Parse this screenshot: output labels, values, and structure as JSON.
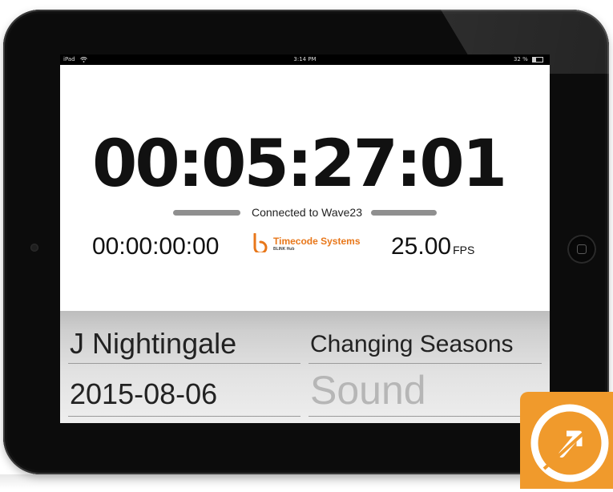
{
  "status_bar": {
    "device": "iPad",
    "time": "3:14 PM",
    "battery": "32 %",
    "battery_level": 0.32
  },
  "timecode": {
    "main": "00:05:27:01",
    "connection_status": "Connected to Wave23",
    "secondary": "00:00:00:00",
    "frame_rate_value": "25.00",
    "frame_rate_unit": "FPS"
  },
  "logo": {
    "name": "Timecode Systems",
    "subtitle": "BLINK Hub",
    "color": "#e8771a"
  },
  "fields": {
    "name": "J Nightingale",
    "production": "Changing Seasons",
    "date": "2015-08-06",
    "department": "Sound"
  },
  "app_badge": {
    "color": "#f09a2c",
    "icon": "sync-arrows-icon"
  }
}
